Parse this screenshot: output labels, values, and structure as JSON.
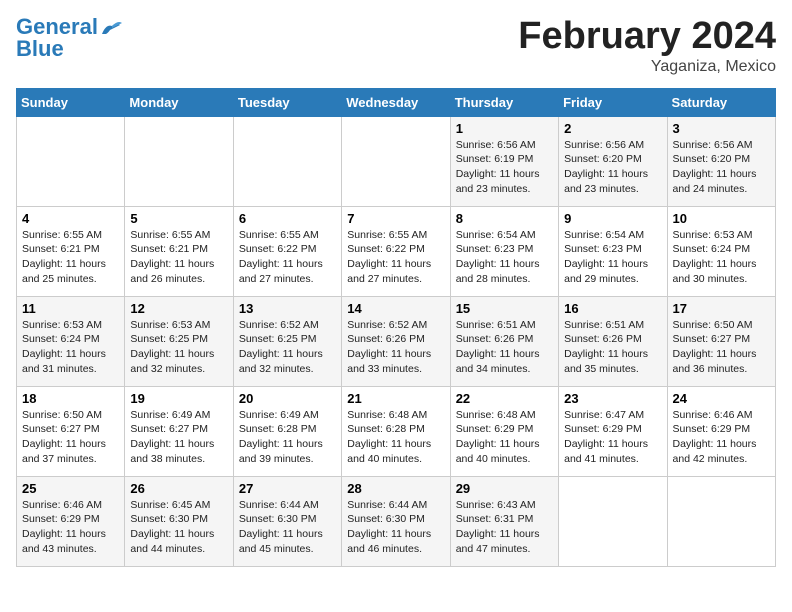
{
  "header": {
    "logo_line1": "General",
    "logo_line2": "Blue",
    "month_title": "February 2024",
    "subtitle": "Yaganiza, Mexico"
  },
  "weekdays": [
    "Sunday",
    "Monday",
    "Tuesday",
    "Wednesday",
    "Thursday",
    "Friday",
    "Saturday"
  ],
  "weeks": [
    [
      {
        "day": "",
        "info": ""
      },
      {
        "day": "",
        "info": ""
      },
      {
        "day": "",
        "info": ""
      },
      {
        "day": "",
        "info": ""
      },
      {
        "day": "1",
        "info": "Sunrise: 6:56 AM\nSunset: 6:19 PM\nDaylight: 11 hours and 23 minutes."
      },
      {
        "day": "2",
        "info": "Sunrise: 6:56 AM\nSunset: 6:20 PM\nDaylight: 11 hours and 23 minutes."
      },
      {
        "day": "3",
        "info": "Sunrise: 6:56 AM\nSunset: 6:20 PM\nDaylight: 11 hours and 24 minutes."
      }
    ],
    [
      {
        "day": "4",
        "info": "Sunrise: 6:55 AM\nSunset: 6:21 PM\nDaylight: 11 hours and 25 minutes."
      },
      {
        "day": "5",
        "info": "Sunrise: 6:55 AM\nSunset: 6:21 PM\nDaylight: 11 hours and 26 minutes."
      },
      {
        "day": "6",
        "info": "Sunrise: 6:55 AM\nSunset: 6:22 PM\nDaylight: 11 hours and 27 minutes."
      },
      {
        "day": "7",
        "info": "Sunrise: 6:55 AM\nSunset: 6:22 PM\nDaylight: 11 hours and 27 minutes."
      },
      {
        "day": "8",
        "info": "Sunrise: 6:54 AM\nSunset: 6:23 PM\nDaylight: 11 hours and 28 minutes."
      },
      {
        "day": "9",
        "info": "Sunrise: 6:54 AM\nSunset: 6:23 PM\nDaylight: 11 hours and 29 minutes."
      },
      {
        "day": "10",
        "info": "Sunrise: 6:53 AM\nSunset: 6:24 PM\nDaylight: 11 hours and 30 minutes."
      }
    ],
    [
      {
        "day": "11",
        "info": "Sunrise: 6:53 AM\nSunset: 6:24 PM\nDaylight: 11 hours and 31 minutes."
      },
      {
        "day": "12",
        "info": "Sunrise: 6:53 AM\nSunset: 6:25 PM\nDaylight: 11 hours and 32 minutes."
      },
      {
        "day": "13",
        "info": "Sunrise: 6:52 AM\nSunset: 6:25 PM\nDaylight: 11 hours and 32 minutes."
      },
      {
        "day": "14",
        "info": "Sunrise: 6:52 AM\nSunset: 6:26 PM\nDaylight: 11 hours and 33 minutes."
      },
      {
        "day": "15",
        "info": "Sunrise: 6:51 AM\nSunset: 6:26 PM\nDaylight: 11 hours and 34 minutes."
      },
      {
        "day": "16",
        "info": "Sunrise: 6:51 AM\nSunset: 6:26 PM\nDaylight: 11 hours and 35 minutes."
      },
      {
        "day": "17",
        "info": "Sunrise: 6:50 AM\nSunset: 6:27 PM\nDaylight: 11 hours and 36 minutes."
      }
    ],
    [
      {
        "day": "18",
        "info": "Sunrise: 6:50 AM\nSunset: 6:27 PM\nDaylight: 11 hours and 37 minutes."
      },
      {
        "day": "19",
        "info": "Sunrise: 6:49 AM\nSunset: 6:27 PM\nDaylight: 11 hours and 38 minutes."
      },
      {
        "day": "20",
        "info": "Sunrise: 6:49 AM\nSunset: 6:28 PM\nDaylight: 11 hours and 39 minutes."
      },
      {
        "day": "21",
        "info": "Sunrise: 6:48 AM\nSunset: 6:28 PM\nDaylight: 11 hours and 40 minutes."
      },
      {
        "day": "22",
        "info": "Sunrise: 6:48 AM\nSunset: 6:29 PM\nDaylight: 11 hours and 40 minutes."
      },
      {
        "day": "23",
        "info": "Sunrise: 6:47 AM\nSunset: 6:29 PM\nDaylight: 11 hours and 41 minutes."
      },
      {
        "day": "24",
        "info": "Sunrise: 6:46 AM\nSunset: 6:29 PM\nDaylight: 11 hours and 42 minutes."
      }
    ],
    [
      {
        "day": "25",
        "info": "Sunrise: 6:46 AM\nSunset: 6:29 PM\nDaylight: 11 hours and 43 minutes."
      },
      {
        "day": "26",
        "info": "Sunrise: 6:45 AM\nSunset: 6:30 PM\nDaylight: 11 hours and 44 minutes."
      },
      {
        "day": "27",
        "info": "Sunrise: 6:44 AM\nSunset: 6:30 PM\nDaylight: 11 hours and 45 minutes."
      },
      {
        "day": "28",
        "info": "Sunrise: 6:44 AM\nSunset: 6:30 PM\nDaylight: 11 hours and 46 minutes."
      },
      {
        "day": "29",
        "info": "Sunrise: 6:43 AM\nSunset: 6:31 PM\nDaylight: 11 hours and 47 minutes."
      },
      {
        "day": "",
        "info": ""
      },
      {
        "day": "",
        "info": ""
      }
    ]
  ]
}
